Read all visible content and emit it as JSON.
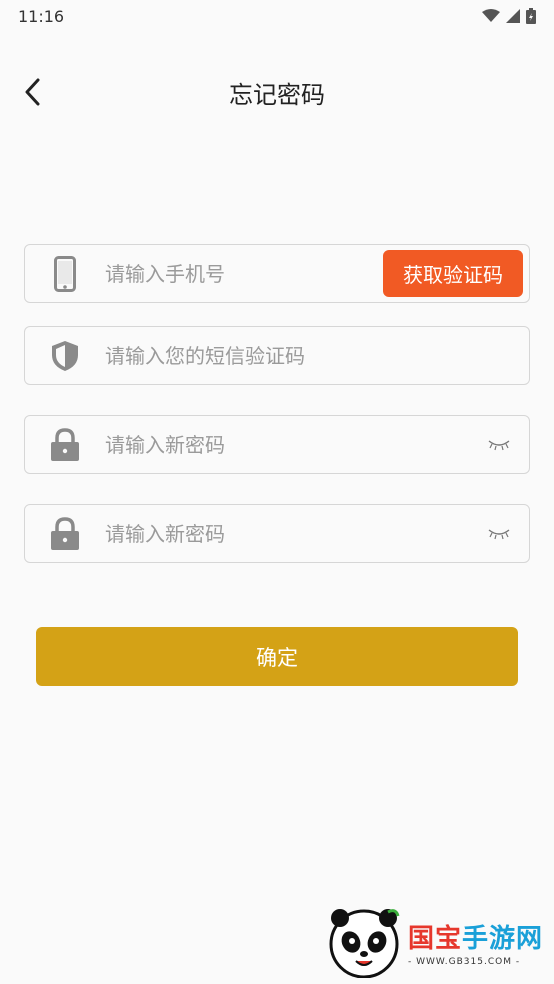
{
  "status_bar": {
    "time": "11:16",
    "icons": [
      "wifi-icon",
      "signal-icon",
      "battery-icon"
    ]
  },
  "nav": {
    "title": "忘记密码",
    "back_icon": "chevron-left-icon"
  },
  "form": {
    "phone": {
      "placeholder": "请输入手机号",
      "icon": "phone-icon",
      "value": ""
    },
    "get_code_button": "获取验证码",
    "sms_code": {
      "placeholder": "请输入您的短信验证码",
      "icon": "shield-icon",
      "value": ""
    },
    "new_password": {
      "placeholder": "请输入新密码",
      "icon": "lock-icon",
      "toggle_icon": "eye-closed-icon",
      "value": ""
    },
    "confirm_password": {
      "placeholder": "请输入新密码",
      "icon": "lock-icon",
      "toggle_icon": "eye-closed-icon",
      "value": ""
    },
    "submit_button": "确定"
  },
  "watermark": {
    "name_part1": "国宝",
    "name_part2": "手游网",
    "url": "- WWW.GB315.COM -"
  },
  "colors": {
    "background": "#fafafa",
    "get_code_button": "#f15a24",
    "submit_button": "#d4a216",
    "border": "#d6d6d6",
    "placeholder": "#9a9a9a",
    "icon_gray": "#8a8a8a"
  }
}
